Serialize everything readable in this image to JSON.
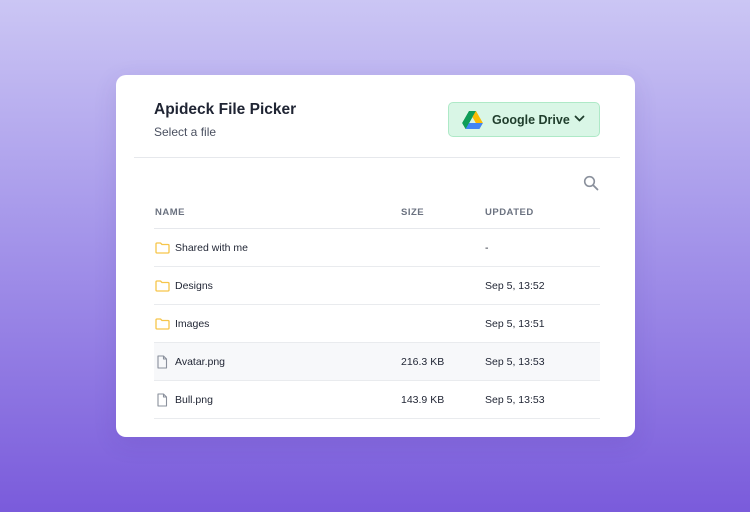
{
  "header": {
    "title": "Apideck File Picker",
    "subtitle": "Select a file"
  },
  "provider": {
    "label": "Google Drive",
    "icon": "google-drive-icon"
  },
  "table": {
    "columns": [
      "NAME",
      "SIZE",
      "UPDATED"
    ],
    "rows": [
      {
        "type": "folder",
        "name": "Shared with me",
        "size": "",
        "updated": "-"
      },
      {
        "type": "folder",
        "name": "Designs",
        "size": "",
        "updated": "Sep 5, 13:52"
      },
      {
        "type": "folder",
        "name": "Images",
        "size": "",
        "updated": "Sep 5, 13:51"
      },
      {
        "type": "file",
        "name": "Avatar.png",
        "size": "216.3 KB",
        "updated": "Sep 5, 13:53"
      },
      {
        "type": "file",
        "name": "Bull.png",
        "size": "143.9 KB",
        "updated": "Sep 5, 13:53"
      }
    ]
  },
  "colors": {
    "folder": "#f6c54a",
    "provider_bg": "#d9f6e6",
    "provider_border": "#aee9c7",
    "row_hover": "#f7f8fa"
  }
}
